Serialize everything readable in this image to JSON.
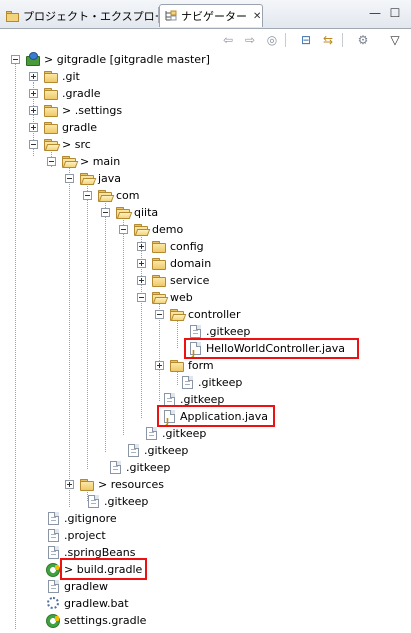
{
  "tabs": {
    "project_explorer": "プロジェクト・エクスプローラー",
    "navigator": "ナビゲーター",
    "close_glyph": "✕"
  },
  "window_controls": {
    "minimize": "—",
    "maximize": "☐"
  },
  "toolbar": {
    "back": "⇦",
    "forward": "⇨",
    "up": "◎",
    "collapse_all": "⊟",
    "link_editor": "⇆",
    "view_menu": "▽",
    "filters": "⚙"
  },
  "colors": {
    "highlight_border": "#ee1111",
    "tree_lines": "#9aa0a6"
  },
  "tree": {
    "project": "> gitgradle  [gitgradle master]",
    "git": ".git",
    "gradle_dir": ".gradle",
    "settings_dir": "> .settings",
    "gradle": "gradle",
    "src": "> src",
    "main": "> main",
    "java": "java",
    "com": "com",
    "qiita": "qiita",
    "demo": "demo",
    "config": "config",
    "domain": "domain",
    "service": "service",
    "web": "web",
    "controller": "controller",
    "controller_gitkeep": ".gitkeep",
    "hello_controller": "HelloWorldController.java",
    "form": "form",
    "form_gitkeep": ".gitkeep",
    "web_gitkeep": ".gitkeep",
    "application": "Application.java",
    "demo_gitkeep": ".gitkeep",
    "qiita_gitkeep": ".gitkeep",
    "com_gitkeep": ".gitkeep",
    "resources": "> resources",
    "main_gitkeep": ".gitkeep",
    "gitignore": ".gitignore",
    "dot_project": ".project",
    "springbeans": ".springBeans",
    "build_gradle": "> build.gradle",
    "gradlew": "gradlew",
    "gradlew_bat": "gradlew.bat",
    "settings_gradle": "settings.gradle"
  }
}
